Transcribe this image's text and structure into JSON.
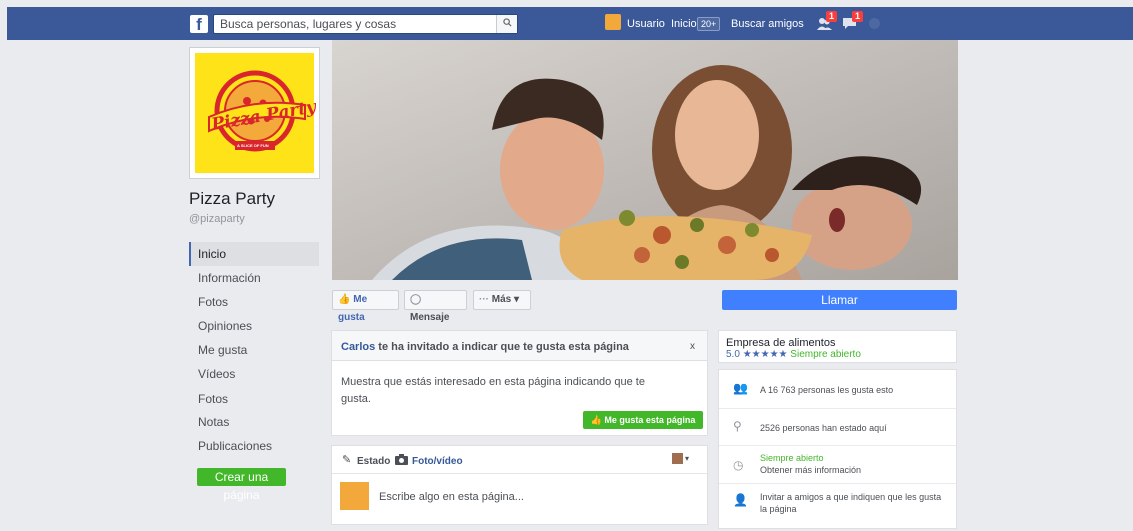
{
  "topbar": {
    "logo": "f",
    "search_placeholder": "Busca personas, lugares y cosas",
    "search_icon": "search-icon",
    "user_label": "Usuario",
    "home_label": "Inicio",
    "home_badge": "20+",
    "find_friends_label": "Buscar amigos",
    "friend_requests_badge": "1",
    "messages_badge": "1"
  },
  "profile": {
    "page_name": "Pizza Party",
    "handle": "@pizaparty",
    "logo_text": "Pizza Party",
    "logo_subtext": "A SLICE OF FUN"
  },
  "sidebar": {
    "items": [
      {
        "label": "Inicio"
      },
      {
        "label": "Información"
      },
      {
        "label": "Fotos"
      },
      {
        "label": "Opiniones"
      },
      {
        "label": "Me gusta"
      },
      {
        "label": "Vídeos"
      },
      {
        "label": "Fotos"
      },
      {
        "label": "Notas"
      },
      {
        "label": "Publicaciones"
      }
    ],
    "create_page_label": "Crear una página"
  },
  "actions": {
    "like_label": "Me gusta",
    "message_label": "Mensaje",
    "more_label": "Más",
    "call_label": "Llamar"
  },
  "invite": {
    "inviter": "Carlos",
    "title_rest": " te ha invitado a indicar que te gusta esta página",
    "close": "x",
    "body": "Muestra que estás interesado en esta página indicando que te gusta.",
    "like_page_label": "Me gusta esta página"
  },
  "composer": {
    "status_tab": "Estado",
    "photo_tab": "Foto/vídeo",
    "placeholder": "Escribe algo en esta página..."
  },
  "about": {
    "category": "Empresa de alimentos",
    "rating": "5.0",
    "stars": "★★★★★",
    "open_label": "Siempre abierto",
    "likes_text": "A 16 763 personas les gusta esto",
    "checkins_text": "2526 personas han estado aquí",
    "hours_open": "Siempre abierto",
    "hours_more": "Obtener más información",
    "invite_friends_text": "Invitar a amigos a que indiquen que les gusta la página"
  },
  "colors": {
    "brand_blue": "#3b5998",
    "accent_blue": "#4080ff",
    "green": "#42b72a",
    "logo_yellow": "#fde317",
    "logo_red": "#d9262c"
  }
}
